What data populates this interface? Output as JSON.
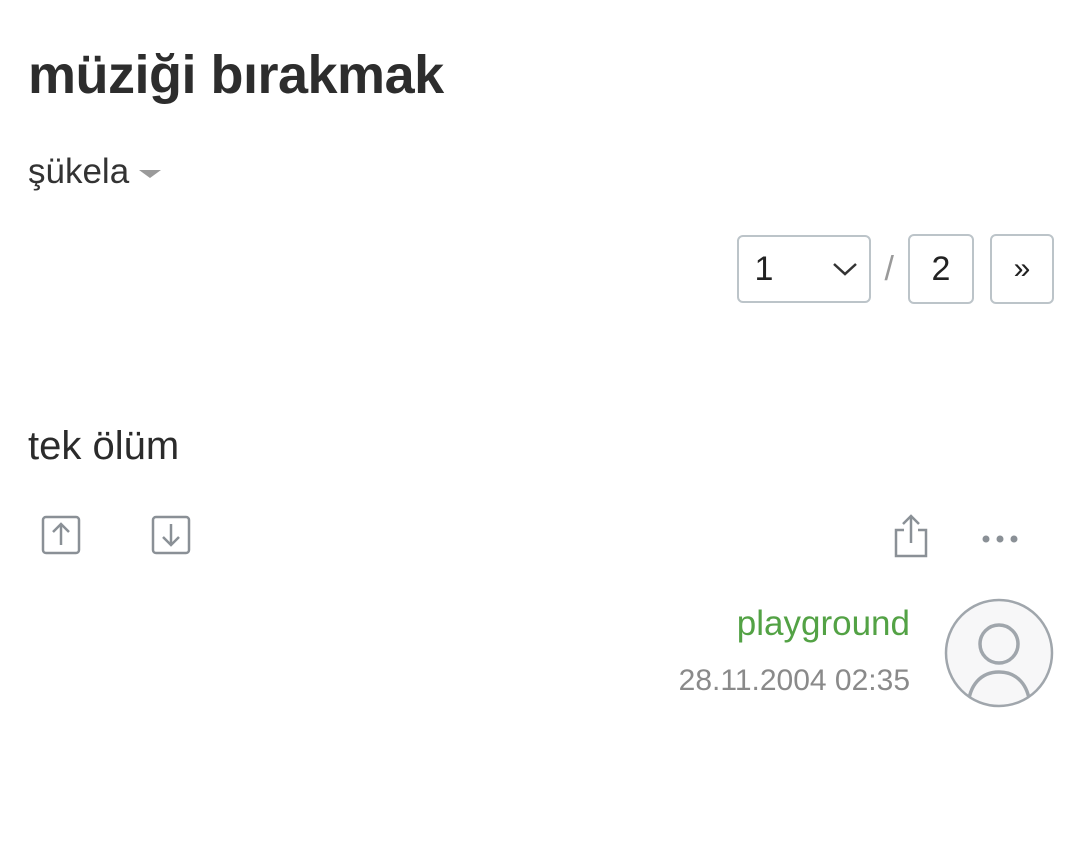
{
  "topic": {
    "title": "müziği bırakmak"
  },
  "sort": {
    "label": "şükela"
  },
  "pager": {
    "current_page": "1",
    "separator": "/",
    "total_pages": "2",
    "next_label": "»"
  },
  "entry": {
    "text": "tek ölüm",
    "author": "playground",
    "date": "28.11.2004 02:35"
  },
  "colors": {
    "author": "#53a245",
    "border": "#bcc4c9",
    "icon": "#8a9096"
  },
  "icons": [
    "upvote-icon",
    "downvote-icon",
    "share-icon",
    "more-icon",
    "user-avatar-icon",
    "chevron-down-icon",
    "caret-down-icon"
  ]
}
